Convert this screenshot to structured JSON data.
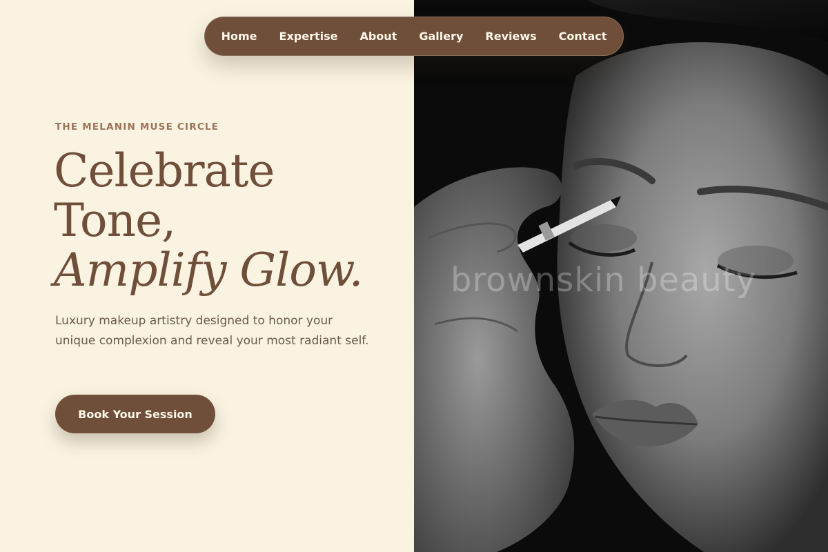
{
  "nav": {
    "items": [
      {
        "label": "Home"
      },
      {
        "label": "Expertise"
      },
      {
        "label": "About"
      },
      {
        "label": "Gallery"
      },
      {
        "label": "Reviews"
      },
      {
        "label": "Contact"
      }
    ]
  },
  "hero": {
    "eyebrow": "THE MELANIN MUSE CIRCLE",
    "headline_line1": "Celebrate",
    "headline_line2": "Tone,",
    "headline_line3": "Amplify Glow.",
    "subtext": "Luxury makeup artistry designed to honor your unique complexion and reveal your most radiant self.",
    "cta_label": "Book Your Session"
  },
  "photo": {
    "watermark": "brownskin beauty"
  },
  "colors": {
    "background": "#faf3e1",
    "brand_brown": "#6f4f39",
    "eyebrow": "#9b7358",
    "body_text": "#6b5a4d"
  }
}
